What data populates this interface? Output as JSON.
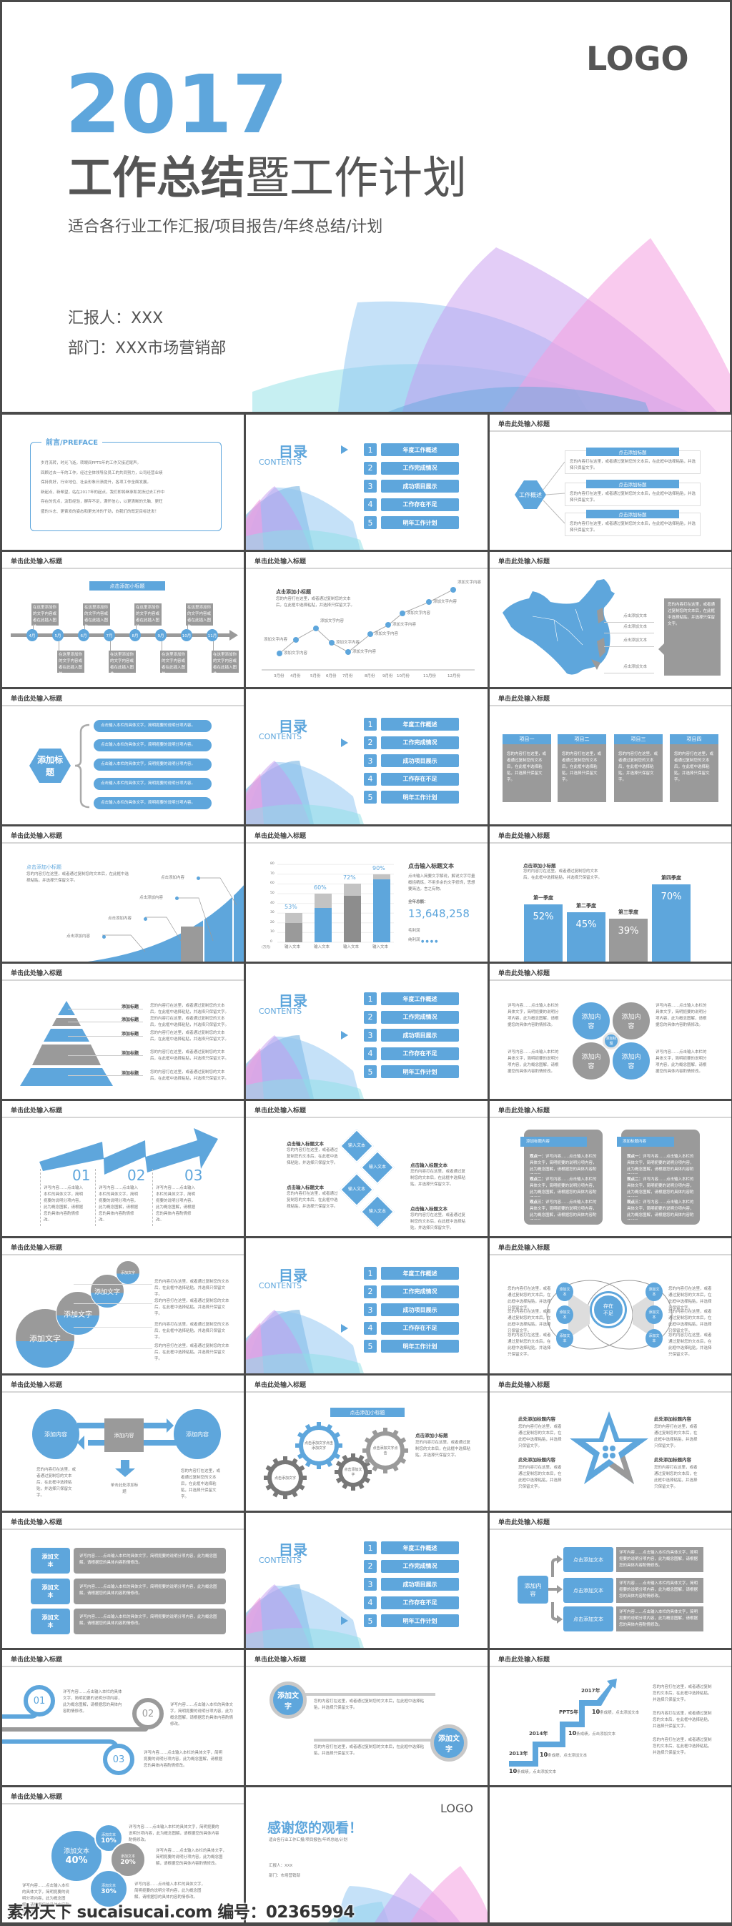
{
  "hero": {
    "logo": "LOGO",
    "year": "2017",
    "title_bold": "工作总结",
    "title_rest": "暨工作计划",
    "subtitle": "适合各行业工作汇报/项目报告/年终总结/计划",
    "reporter": "汇报人：XXX",
    "department": "部门：XXX市场营销部"
  },
  "common": {
    "slide_title": "单击此处输入标题",
    "sub_title": "点击添加小标题",
    "body": "您的内容打在这里，或者通过复制您的文本后，在此框中选择粘贴，并选择只保留文字。",
    "body_short": "点击输入本栏的具体文字，简明扼要的说明分项内容。",
    "detail": "详写内容……点击输入本栏的具体文字，简明扼要的说明分项内容，此为概念图解，请根据您的具体内容酌情修改。",
    "add_text": "添加文本",
    "add_content": "添加内容",
    "add_title": "添加标题",
    "add_words": "添加文字",
    "input_text": "输入文本",
    "click_add_text": "点击添加文本",
    "click_add_content": "点击添加内容",
    "click_add_title": "点击添加标题",
    "input_title_text": "点击输入标题文本",
    "add_text_content": "添加文字内容",
    "title_content": "此处添加标题内容",
    "add_title_content": "添加标题内容"
  },
  "contents": {
    "title": "目录",
    "subtitle": "CONTENTS",
    "items": [
      {
        "num": "1",
        "label": "年度工作概述"
      },
      {
        "num": "2",
        "label": "工作完成情况"
      },
      {
        "num": "3",
        "label": "成功项目展示"
      },
      {
        "num": "4",
        "label": "工作存在不足"
      },
      {
        "num": "5",
        "label": "明年工作计划"
      }
    ],
    "active_per_slide": [
      1,
      2,
      3,
      4,
      5
    ]
  },
  "preface": {
    "tag": "前言/PREFACE",
    "lines": [
      "岁月流转，时光飞逝，转眼间PPTS年的工作又接近尾声。",
      "回顾过去一年的工作，经过全体领导及员工的共同努力，公司经营业绩",
      "保持良好，行业地位、社会形象日渐提升，各项工作全面发展。",
      "新起点、新希望，站在2017年的起点，我们即将继承和发扬过去工作中",
      "存在的优点，汲取经验，摒弃不足，满怀信心，以更清晰的头脑、更旺",
      "盛的斗志、更奋发的姿态和更充沛的干劲，向我们的既定目标进发！"
    ]
  },
  "overview": {
    "hex": "工作概述"
  },
  "timeline": {
    "months": [
      "4月",
      "5月",
      "6月",
      "7月",
      "8月",
      "9月",
      "10月",
      "11月"
    ],
    "box_text": "在这里添加你的文字内容或者在此插入图片"
  },
  "map": {
    "labels": [
      "点击添加文本",
      "点击添加文本",
      "点击添加文本",
      "点击添加文本"
    ]
  },
  "projects": {
    "names": [
      "项目一",
      "项目二",
      "项目三",
      "项目四"
    ]
  },
  "quarters_text": {
    "title": "点击添加小标题"
  },
  "bar_side": {
    "title": "点击输入标题文本",
    "desc": "点击输入简要文字解说，解说文字尽量概括精炼，不用多余的文字修饰，思想要简洁，言之有物。",
    "total_label": "全年总额：",
    "total": "13,648,258",
    "gross": "毛利润",
    "net": "纯利润",
    "unit": "(万元)"
  },
  "zigzag": {
    "nums": [
      "01",
      "02",
      "03"
    ]
  },
  "cards": {
    "points": [
      "观点一：",
      "观点二：",
      "观点三："
    ]
  },
  "shortfall": {
    "center": "存在不足"
  },
  "flow": {
    "bottom_title": "单击此处添加标题"
  },
  "gears": {
    "texts": [
      "点击添加文字点击添加文字",
      "点击添加文字",
      "点击添加文字",
      "点击添加文字点击"
    ],
    "side_title": "点击添加小标题"
  },
  "rings": {
    "nums": [
      "01",
      "02",
      "03"
    ]
  },
  "stairs": {
    "years": [
      "2013年",
      "2014年",
      "PPTS年",
      "2017年"
    ],
    "num": "10",
    "item": "条成绩，点击添加文本"
  },
  "flower": {
    "items": [
      {
        "label": "添加文本",
        "pct": "40%"
      },
      {
        "label": "添加文本",
        "pct": "10%"
      },
      {
        "label": "添加文本",
        "pct": "20%"
      },
      {
        "label": "添加文本",
        "pct": "30%"
      }
    ]
  },
  "thanks": {
    "logo": "LOGO",
    "title": "感谢您的观看！",
    "subtitle": "适合各行业工作汇报/项目报告/年终总结/计划",
    "reporter": "汇报人：XXX",
    "department": "部门：市场营销部"
  },
  "watermark": "素材天下 sucaisucai.com  编号：02365994",
  "colors": {
    "accent": "#5ea6dc",
    "gray": "#9a9a9a",
    "pink": "#f49ee0",
    "purple": "#c79cf0"
  },
  "chart_data": [
    {
      "type": "line",
      "title": "点击添加小标题",
      "categories": [
        "3月份",
        "4月份",
        "5月份",
        "6月份",
        "7月份",
        "8月份",
        "9月份",
        "10月份",
        "11月份",
        "12月份"
      ],
      "values": [
        12,
        33,
        50,
        28,
        14,
        41,
        55,
        73,
        90,
        109
      ],
      "point_label": "添加文字内容"
    },
    {
      "type": "bar",
      "stacked": true,
      "categories": [
        "输入文本",
        "输入文本",
        "输入文本",
        "输入文本"
      ],
      "ylim": [
        0,
        80
      ],
      "yticks": [
        0,
        10,
        20,
        30,
        40,
        50,
        60,
        70,
        80
      ],
      "ylabel": "(万元)",
      "series": [
        {
          "values": [
            20,
            35,
            48,
            65
          ]
        },
        {
          "values": [
            10,
            15,
            12,
            5
          ]
        }
      ],
      "data_labels": [
        "53%",
        "60%",
        "72%",
        "90%"
      ]
    },
    {
      "type": "bar",
      "categories": [
        "第一季度",
        "第二季度",
        "第三季度",
        "第四季度"
      ],
      "values": [
        52,
        45,
        39,
        70
      ],
      "data_labels": [
        "52%",
        "45%",
        "39%",
        "70%"
      ]
    }
  ]
}
